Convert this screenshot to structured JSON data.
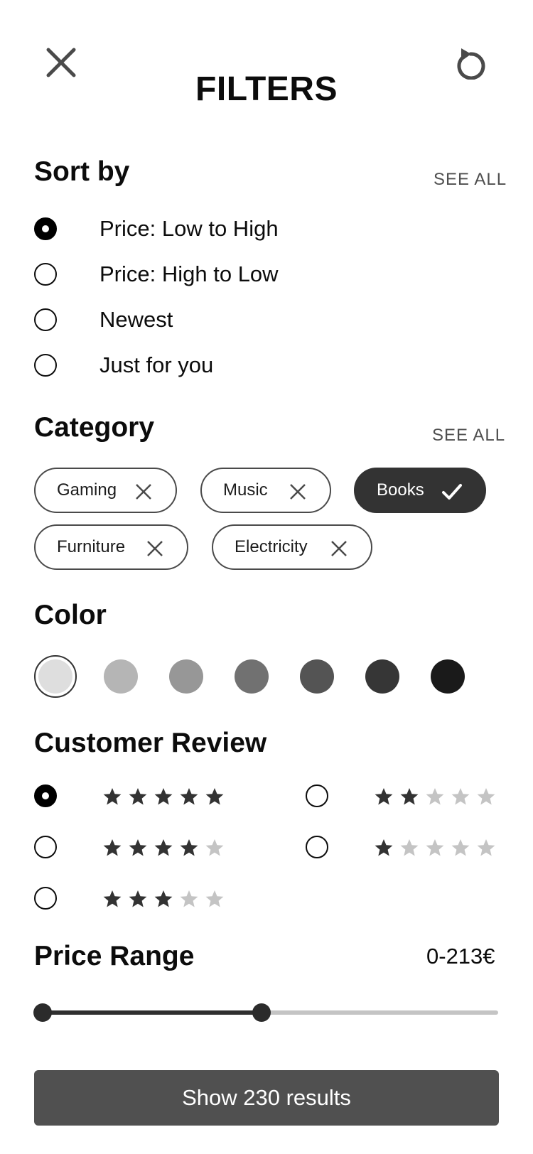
{
  "header": {
    "title": "FILTERS",
    "close_icon": "close-icon",
    "reset_icon": "reset-icon"
  },
  "sort": {
    "title": "Sort by",
    "see_all": "SEE ALL",
    "options": [
      {
        "label": "Price: Low to High",
        "selected": true
      },
      {
        "label": "Price: High to Low",
        "selected": false
      },
      {
        "label": "Newest",
        "selected": false
      },
      {
        "label": "Just for you",
        "selected": false
      }
    ]
  },
  "category": {
    "title": "Category",
    "see_all": "SEE ALL",
    "chips": [
      {
        "label": "Gaming",
        "active": false,
        "icon": "close-icon"
      },
      {
        "label": "Music",
        "active": false,
        "icon": "close-icon"
      },
      {
        "label": "Books",
        "active": true,
        "icon": "check-icon"
      },
      {
        "label": "Furniture",
        "active": false,
        "icon": "close-icon"
      },
      {
        "label": "Electricity",
        "active": false,
        "icon": "close-icon"
      }
    ]
  },
  "color": {
    "title": "Color",
    "swatches": [
      "#dedede",
      "#b5b5b5",
      "#979797",
      "#717171",
      "#545454",
      "#363636",
      "#1a1a1a"
    ],
    "selected_index": 0
  },
  "review": {
    "title": "Customer Review",
    "options": [
      {
        "stars": 5,
        "selected": true
      },
      {
        "stars": 4,
        "selected": false
      },
      {
        "stars": 3,
        "selected": false
      },
      {
        "stars": 2,
        "selected": false
      },
      {
        "stars": 1,
        "selected": false
      }
    ],
    "star_filled_color": "#333333",
    "star_empty_color": "#c4c4c4"
  },
  "price": {
    "title": "Price Range",
    "value": "0-213€",
    "min_fraction": 0.0,
    "max_fraction": 0.48
  },
  "cta": {
    "label": "Show 230 results"
  }
}
